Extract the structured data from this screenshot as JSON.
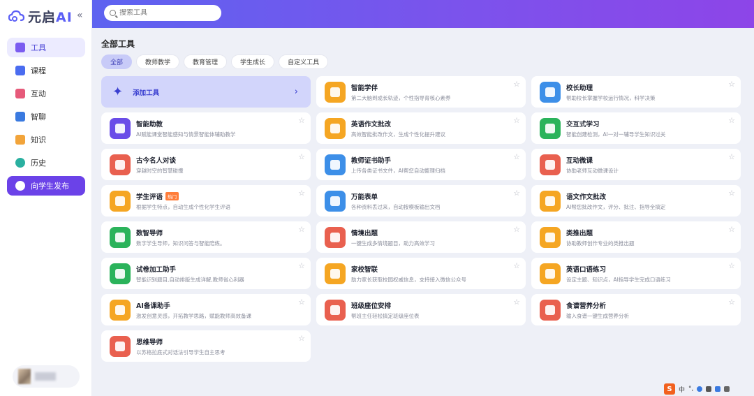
{
  "app": {
    "logo_main": "元启",
    "logo_ai": "AI",
    "collapse_glyph": "«"
  },
  "search": {
    "placeholder": "搜索工具"
  },
  "sidebar": {
    "items": [
      {
        "label": "工具",
        "icon": "tools-icon",
        "color": "#7b5cf0",
        "active": true
      },
      {
        "label": "课程",
        "icon": "play-icon",
        "color": "#4a6cf0"
      },
      {
        "label": "互动",
        "icon": "calendar-icon",
        "color": "#e65a7a"
      },
      {
        "label": "智聊",
        "icon": "chat-icon",
        "color": "#3a7ae0"
      },
      {
        "label": "知识",
        "icon": "folder-icon",
        "color": "#f2a43a"
      },
      {
        "label": "历史",
        "icon": "clock-icon",
        "color": "#2ab0a0"
      }
    ],
    "publish": {
      "label": "向学生发布",
      "icon": "send-icon"
    }
  },
  "main": {
    "title": "全部工具",
    "filters": [
      "全部",
      "教师教学",
      "教育管理",
      "学生成长",
      "自定义工具"
    ],
    "add_tool": {
      "label": "添加工具",
      "chevron": "›"
    },
    "star": "☆",
    "tools": [
      {
        "name": "智能学伴",
        "desc": "第二大脑到成长轨迹，个性指导育核心素养",
        "color": "#f5a623",
        "icon": "companion-icon"
      },
      {
        "name": "校长助理",
        "desc": "帮助校长掌握学校运行情况，科学决策",
        "color": "#3d8fe8",
        "icon": "robot-icon"
      },
      {
        "name": "智能助教",
        "desc": "AI赋能课堂智能感知与情景智能体辅助教学",
        "color": "#6a4ce8",
        "icon": "assistant-icon"
      },
      {
        "name": "英语作文批改",
        "desc": "高效智能批改作文，生成个性化提升建议",
        "color": "#f5a623",
        "icon": "en-essay-icon"
      },
      {
        "name": "交互式学习",
        "desc": "智能创建检测，AI一对一辅导学生知识过关",
        "color": "#2bb35b",
        "icon": "interactive-icon"
      },
      {
        "name": "古今名人对谈",
        "desc": "穿越时空的智慧碰撞",
        "color": "#e9604f",
        "icon": "portrait-icon"
      },
      {
        "name": "教师证书助手",
        "desc": "上传各类证书文件，AI帮您自动整理归档",
        "color": "#3d8fe8",
        "icon": "certificate-icon"
      },
      {
        "name": "互动微课",
        "desc": "协助老师互动微课设计",
        "color": "#e9604f",
        "icon": "video-icon"
      },
      {
        "name": "学生评语",
        "desc": "根据学生特点，自动生成个性化学生评语",
        "color": "#f5a623",
        "icon": "comment-icon",
        "badge": "热门"
      },
      {
        "name": "万能表单",
        "desc": "各种资料丢过来，自动按模板输出文档",
        "color": "#3d8fe8",
        "icon": "form-icon"
      },
      {
        "name": "语文作文批改",
        "desc": "AI帮您批改作文，评分、批注、指导全搞定",
        "color": "#f5a623",
        "icon": "essay-icon"
      },
      {
        "name": "数智导师",
        "desc": "数字学生导师，知识问答与智能陪练。",
        "color": "#2bb35b",
        "icon": "tutor-icon"
      },
      {
        "name": "情境出题",
        "desc": "一键生成多情境题目，助力高效学习",
        "color": "#e9604f",
        "icon": "scenario-icon"
      },
      {
        "name": "类推出题",
        "desc": "协助教师创作专业的类推出题",
        "color": "#f5a623",
        "icon": "analogy-icon"
      },
      {
        "name": "试卷加工助手",
        "desc": "智能识别题目,自动排版生成详解,教师省心利器",
        "color": "#2bb35b",
        "icon": "exam-icon"
      },
      {
        "name": "家校智联",
        "desc": "助力家长获取校园权威信息，支持接入微信公众号",
        "color": "#f5a623",
        "icon": "home-school-icon"
      },
      {
        "name": "英语口语练习",
        "desc": "设定主题、知识点，AI指导学生完成口语练习",
        "color": "#f5a623",
        "icon": "abc-icon"
      },
      {
        "name": "AI备课助手",
        "desc": "激发创意灵感，开拓教学思路，赋能教师高效备课",
        "color": "#f5a623",
        "icon": "lesson-icon"
      },
      {
        "name": "班级座位安排",
        "desc": "帮班主任轻松搞定班级座位表",
        "color": "#e9604f",
        "icon": "seating-icon"
      },
      {
        "name": "食谱营养分析",
        "desc": "输入食谱一键生成营养分析",
        "color": "#e9604f",
        "icon": "bowl-icon"
      },
      {
        "name": "思维导师",
        "desc": "以苏格拉底式对话法引导学生自主思考",
        "color": "#e9604f",
        "icon": "brain-icon"
      }
    ]
  },
  "ime": {
    "logo": "S",
    "lang": "中",
    "punct": "°,"
  }
}
